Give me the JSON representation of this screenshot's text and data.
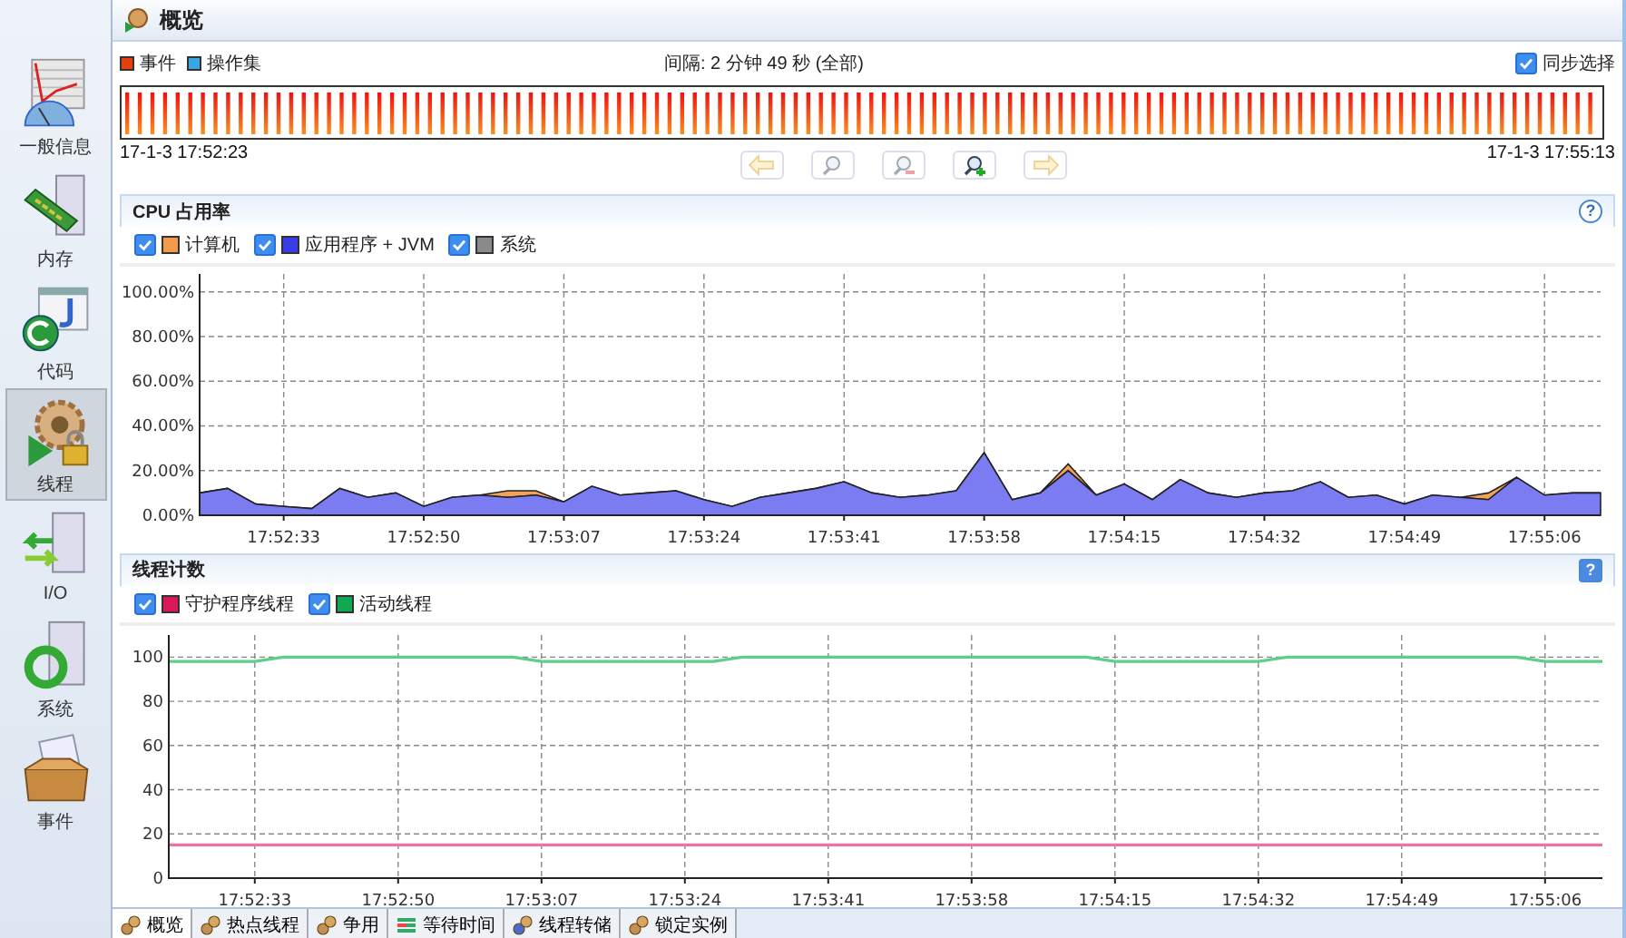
{
  "sidebar": {
    "items": [
      {
        "label": "一般信息",
        "kind": "general",
        "selected": false
      },
      {
        "label": "内存",
        "kind": "memory",
        "selected": false
      },
      {
        "label": "代码",
        "kind": "code",
        "selected": false
      },
      {
        "label": "线程",
        "kind": "threads",
        "selected": true
      },
      {
        "label": "I/O",
        "kind": "io",
        "selected": false
      },
      {
        "label": "系统",
        "kind": "system",
        "selected": false
      },
      {
        "label": "事件",
        "kind": "events",
        "selected": false
      }
    ]
  },
  "header": {
    "title": "概览"
  },
  "events": {
    "legend": [
      {
        "label": "事件",
        "color": "#e8400c"
      },
      {
        "label": "操作集",
        "color": "#3aa8e0"
      }
    ],
    "interval": "间隔: 2 分钟 49 秒 (全部)",
    "sync": {
      "label": "同步选择",
      "checked": true
    },
    "start": "17-1-3 17:52:23",
    "end": "17-1-3 17:55:13",
    "buttons": [
      {
        "kind": "back",
        "disabled": true
      },
      {
        "kind": "zoom-fit",
        "disabled": true
      },
      {
        "kind": "zoom-out",
        "disabled": true
      },
      {
        "kind": "zoom-in",
        "disabled": false
      },
      {
        "kind": "forward",
        "disabled": true
      }
    ]
  },
  "cpu": {
    "title": "CPU 占用率",
    "help": "?",
    "legend": [
      {
        "label": "计算机",
        "checked": true,
        "color": "#f29b4a"
      },
      {
        "label": "应用程序 + JVM",
        "checked": true,
        "color": "#3b3bea"
      },
      {
        "label": "系统",
        "checked": true,
        "color": "#8a8a8a"
      }
    ],
    "chart_data": {
      "type": "area",
      "stacked": true,
      "categories": [
        null,
        null,
        null,
        "17:52:33",
        null,
        null,
        null,
        null,
        "17:52:50",
        null,
        null,
        null,
        null,
        "17:53:07",
        null,
        null,
        null,
        null,
        "17:53:24",
        null,
        null,
        null,
        null,
        "17:53:41",
        null,
        null,
        null,
        null,
        "17:53:58",
        null,
        null,
        null,
        null,
        "17:54:15",
        null,
        null,
        null,
        null,
        "17:54:32",
        null,
        null,
        null,
        null,
        "17:54:49",
        null,
        null,
        null,
        null,
        "17:55:06",
        null,
        null
      ],
      "series": [
        {
          "color": "#7b7bf2",
          "values": [
            10,
            12,
            5,
            4,
            3,
            12,
            8,
            10,
            4,
            8,
            9,
            8,
            9,
            6,
            13,
            9,
            10,
            11,
            7,
            4,
            8,
            10,
            12,
            15,
            10,
            8,
            9,
            11,
            28,
            7,
            10,
            20,
            9,
            14,
            7,
            16,
            10,
            8,
            10,
            11,
            15,
            8,
            9,
            5,
            9,
            8,
            7,
            17,
            9,
            10,
            10
          ]
        },
        {
          "color": "#f2a35a",
          "values": [
            0,
            0,
            0,
            0,
            0,
            0,
            0,
            0,
            0,
            0,
            0,
            3,
            2,
            0,
            0,
            0,
            0,
            0,
            0,
            0,
            0,
            0,
            0,
            0,
            0,
            0,
            0,
            0,
            0,
            0,
            0,
            3,
            0,
            0,
            0,
            0,
            0,
            0,
            0,
            0,
            0,
            0,
            0,
            0,
            0,
            0,
            3,
            0,
            0,
            0,
            0
          ]
        }
      ],
      "grid": true,
      "ylim": [
        0,
        108
      ],
      "yticks": [
        {
          "value": 0,
          "label": "0.00%"
        },
        {
          "value": 20,
          "label": "20.00%"
        },
        {
          "value": 40,
          "label": "40.00%"
        },
        {
          "value": 60,
          "label": "60.00%"
        },
        {
          "value": 80,
          "label": "80.00%"
        },
        {
          "value": 100,
          "label": "100.00%"
        }
      ]
    }
  },
  "threads": {
    "title": "线程计数",
    "help": "?",
    "legend": [
      {
        "label": "守护程序线程",
        "checked": true,
        "color": "#d8185a"
      },
      {
        "label": "活动线程",
        "checked": true,
        "color": "#10a850"
      }
    ],
    "chart_data": {
      "type": "line",
      "categories": [
        null,
        null,
        null,
        "17:52:33",
        null,
        null,
        null,
        null,
        "17:52:50",
        null,
        null,
        null,
        null,
        "17:53:07",
        null,
        null,
        null,
        null,
        "17:53:24",
        null,
        null,
        null,
        null,
        "17:53:41",
        null,
        null,
        null,
        null,
        "17:53:58",
        null,
        null,
        null,
        null,
        "17:54:15",
        null,
        null,
        null,
        null,
        "17:54:32",
        null,
        null,
        null,
        null,
        "17:54:49",
        null,
        null,
        null,
        null,
        "17:55:06",
        null,
        null
      ],
      "series": [
        {
          "color": "#f070a8",
          "values": [
            15,
            15,
            15,
            15,
            15,
            15,
            15,
            15,
            15,
            15,
            15,
            15,
            15,
            15,
            15,
            15,
            15,
            15,
            15,
            15,
            15,
            15,
            15,
            15,
            15,
            15,
            15,
            15,
            15,
            15,
            15,
            15,
            15,
            15,
            15,
            15,
            15,
            15,
            15,
            15,
            15,
            15,
            15,
            15,
            15,
            15,
            15,
            15,
            15,
            15,
            15
          ]
        },
        {
          "color": "#5ccf8a",
          "values": [
            98,
            98,
            98,
            98,
            100,
            100,
            100,
            100,
            100,
            100,
            100,
            100,
            100,
            98,
            98,
            98,
            98,
            98,
            98,
            98,
            100,
            100,
            100,
            100,
            100,
            100,
            100,
            100,
            100,
            100,
            100,
            100,
            100,
            98,
            98,
            98,
            98,
            98,
            98,
            100,
            100,
            100,
            100,
            100,
            100,
            100,
            100,
            100,
            98,
            98,
            98
          ]
        }
      ],
      "grid": true,
      "ylim": [
        0,
        110
      ],
      "yticks": [
        0,
        20,
        40,
        60,
        80,
        100
      ]
    }
  },
  "tabs": [
    {
      "label": "概览",
      "kind": "overview",
      "selected": true
    },
    {
      "label": "热点线程",
      "kind": "hot",
      "selected": false
    },
    {
      "label": "争用",
      "kind": "contention",
      "selected": false
    },
    {
      "label": "等待时间",
      "kind": "wait",
      "selected": false
    },
    {
      "label": "线程转储",
      "kind": "dump",
      "selected": false
    },
    {
      "label": "锁定实例",
      "kind": "lock",
      "selected": false
    }
  ]
}
